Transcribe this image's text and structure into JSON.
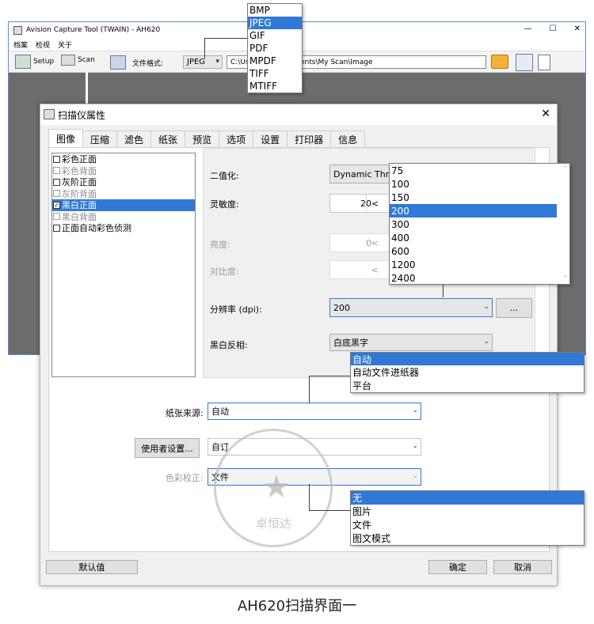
{
  "main_window": {
    "title": "Avision Capture Tool (TWAIN) - AH620",
    "menus": [
      "档案",
      "检视",
      "关于"
    ],
    "toolbar": {
      "setup_label": "Setup",
      "scan_label": "Scan",
      "file_format_label": "文件格式:",
      "file_format_value": "JPEG",
      "path_prefix": "C:\\Use",
      "path_suffix": "ents\\My Scan\\Image"
    }
  },
  "file_format_dropdown": {
    "items": [
      "BMP",
      "JPEG",
      "GIF",
      "PDF",
      "MPDF",
      "TIFF",
      "MTIFF"
    ],
    "selected": "JPEG"
  },
  "dialog": {
    "title": "扫描仪属性",
    "tabs": [
      "图像",
      "压缩",
      "滤色",
      "纸张",
      "预览",
      "选项",
      "设置",
      "打印器",
      "信息"
    ],
    "active_tab": "图像",
    "image_list": [
      {
        "label": "彩色正面",
        "checked": false,
        "disabled": false,
        "selected": false
      },
      {
        "label": "彩色背面",
        "checked": false,
        "disabled": true,
        "selected": false
      },
      {
        "label": "灰阶正面",
        "checked": false,
        "disabled": false,
        "selected": false
      },
      {
        "label": "灰阶背面",
        "checked": false,
        "disabled": true,
        "selected": false
      },
      {
        "label": "黑白正面",
        "checked": true,
        "disabled": false,
        "selected": true
      },
      {
        "label": "黑白背面",
        "checked": false,
        "disabled": true,
        "selected": false
      },
      {
        "label": "正面自动彩色侦测",
        "checked": false,
        "disabled": false,
        "selected": false
      }
    ],
    "binarization_label": "二值化:",
    "binarization_value": "Dynamic Thres",
    "sensitivity_label": "灵敏度:",
    "sensitivity_value": "20",
    "brightness_label": "亮度:",
    "brightness_value": "0",
    "contrast_label": "对比度:",
    "resolution_label": "分辨率 (dpi):",
    "resolution_value": "200",
    "more_button": "...",
    "invert_label": "黑白反相:",
    "invert_value": "白底黑字",
    "paper_source_label": "纸张来源:",
    "paper_source_value": "自动",
    "user_settings_button": "使用者设置...",
    "user_settings_value": "自订",
    "color_correction_label": "色彩校正:",
    "color_correction_value": "文件",
    "default_button": "默认值",
    "ok_button": "确定",
    "cancel_button": "取消"
  },
  "resolution_dropdown": {
    "items": [
      "75",
      "100",
      "150",
      "200",
      "300",
      "400",
      "600",
      "1200",
      "2400"
    ],
    "selected": "200"
  },
  "paper_source_dropdown": {
    "items": [
      "自动",
      "自动文件进纸器",
      "平台"
    ],
    "selected": "自动"
  },
  "color_correction_dropdown": {
    "items": [
      "无",
      "图片",
      "文件",
      "图文模式"
    ],
    "selected": "无"
  },
  "stamp_text": "卓恒达",
  "caption": "AH620扫描界面一"
}
